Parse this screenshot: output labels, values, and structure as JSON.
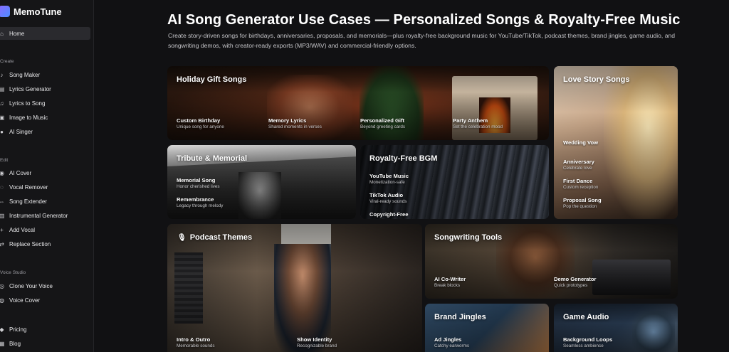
{
  "app": {
    "name": "MemoTune"
  },
  "sidebar": {
    "home": "Home",
    "sections": [
      {
        "label": "Create",
        "items": [
          "Song Maker",
          "Lyrics Generator",
          "Lyrics to Song",
          "Image to Music",
          "AI Singer"
        ]
      },
      {
        "label": "Edit",
        "items": [
          "AI Cover",
          "Vocal Remover",
          "Song Extender",
          "Instrumental Generator",
          "Add Vocal",
          "Replace Section"
        ]
      },
      {
        "label": "Voice Studio",
        "items": [
          "Clone Your Voice",
          "Voice Cover"
        ]
      }
    ],
    "footer": [
      "Pricing",
      "Blog"
    ]
  },
  "page": {
    "title": "AI Song Generator Use Cases — Personalized Songs & Royalty-Free Music",
    "subtitle": "Create story-driven songs for birthdays, anniversaries, proposals, and memorials—plus royalty-free background music for YouTube/TikTok, podcast themes, brand jingles, game audio, and songwriting demos, with creator-ready exports (MP3/WAV) and commercial-friendly options."
  },
  "cards": {
    "holiday": {
      "title": "Holiday Gift Songs",
      "features": [
        {
          "name": "Custom Birthday",
          "desc": "Unique song for anyone"
        },
        {
          "name": "Memory Lyrics",
          "desc": "Shared moments in verses"
        },
        {
          "name": "Personalized Gift",
          "desc": "Beyond greeting cards"
        },
        {
          "name": "Party Anthem",
          "desc": "Set the celebration mood"
        }
      ]
    },
    "love": {
      "title": "Love Story Songs",
      "features": [
        {
          "name": "Wedding Vow",
          "desc": ""
        },
        {
          "name": "Anniversary",
          "desc": "Celebrate love"
        },
        {
          "name": "First Dance",
          "desc": "Custom reception"
        },
        {
          "name": "Proposal Song",
          "desc": "Pop the question"
        }
      ]
    },
    "tribute": {
      "title": "Tribute & Memorial",
      "features": [
        {
          "name": "Memorial Song",
          "desc": "Honor cherished lives"
        },
        {
          "name": "Remembrance",
          "desc": "Legacy through melody"
        }
      ]
    },
    "bgm": {
      "title": "Royalty-Free BGM",
      "features": [
        {
          "name": "YouTube Music",
          "desc": "Monetization-safe"
        },
        {
          "name": "TikTok Audio",
          "desc": "Viral-ready sounds"
        },
        {
          "name": "Copyright-Free",
          "desc": ""
        }
      ]
    },
    "podcast": {
      "title": "Podcast Themes",
      "features": [
        {
          "name": "Intro & Outro",
          "desc": "Memorable sounds"
        },
        {
          "name": "Show Identity",
          "desc": "Recognizable brand"
        }
      ]
    },
    "songwriting": {
      "title": "Songwriting Tools",
      "features": [
        {
          "name": "AI Co-Writer",
          "desc": "Break blocks"
        },
        {
          "name": "Demo Generator",
          "desc": "Quick prototypes"
        }
      ]
    },
    "jingles": {
      "title": "Brand Jingles",
      "features": [
        {
          "name": "Ad Jingles",
          "desc": "Catchy earworms"
        }
      ]
    },
    "game": {
      "title": "Game Audio",
      "features": [
        {
          "name": "Background Loops",
          "desc": "Seamless ambience"
        }
      ]
    }
  },
  "icons": {
    "home": "home-icon",
    "mic": "microphone-icon"
  }
}
